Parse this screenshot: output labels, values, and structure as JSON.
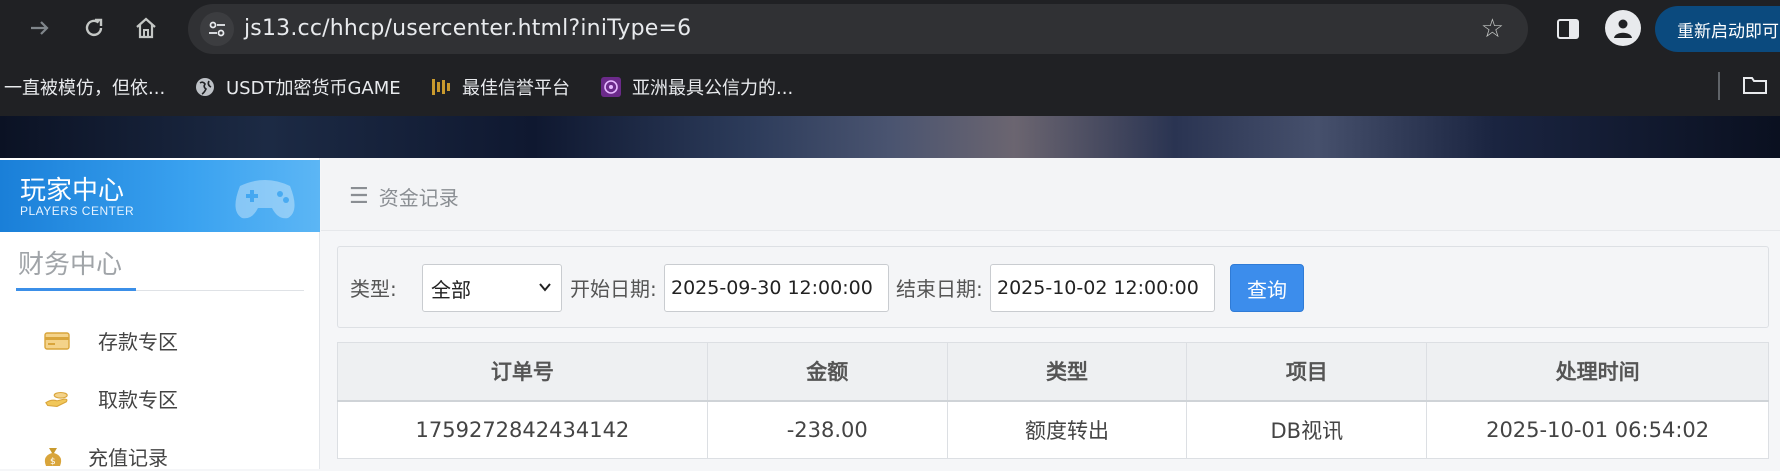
{
  "browser": {
    "url": "js13.cc/hhcp/usercenter.html?iniType=6",
    "restart_label": "重新启动即可",
    "bookmarks": [
      {
        "label": "一直被模仿，但依...",
        "icon": "none"
      },
      {
        "label": "USDT加密货币GAME",
        "icon": "globe-icon"
      },
      {
        "label": "最佳信誉平台",
        "icon": "favicon-gold"
      },
      {
        "label": "亚洲最具公信力的...",
        "icon": "favicon-purple"
      }
    ]
  },
  "sidebar": {
    "header_title": "玩家中心",
    "header_subtitle": "PLAYERS CENTER",
    "section_title": "财务中心",
    "items": [
      {
        "label": "存款专区",
        "icon": "deposit-card-icon"
      },
      {
        "label": "取款专区",
        "icon": "withdraw-hand-icon"
      },
      {
        "label": "充值记录",
        "icon": "money-bag-icon"
      }
    ]
  },
  "main": {
    "breadcrumb": "资金记录",
    "filter": {
      "type_label": "类型:",
      "type_value": "全部",
      "start_label": "开始日期:",
      "start_value": "2025-09-30 12:00:00",
      "end_label": "结束日期:",
      "end_value": "2025-10-02 12:00:00",
      "query_label": "查询"
    },
    "table": {
      "headers": [
        "订单号",
        "金额",
        "类型",
        "项目",
        "处理时间"
      ],
      "rows": [
        [
          "1759272842434142",
          "-238.00",
          "额度转出",
          "DB视讯",
          "2025-10-01 06:54:02"
        ]
      ]
    }
  },
  "colors": {
    "accent": "#3c8dec",
    "header_gradient_start": "#1a7fd8",
    "chrome_bg": "#202124"
  }
}
